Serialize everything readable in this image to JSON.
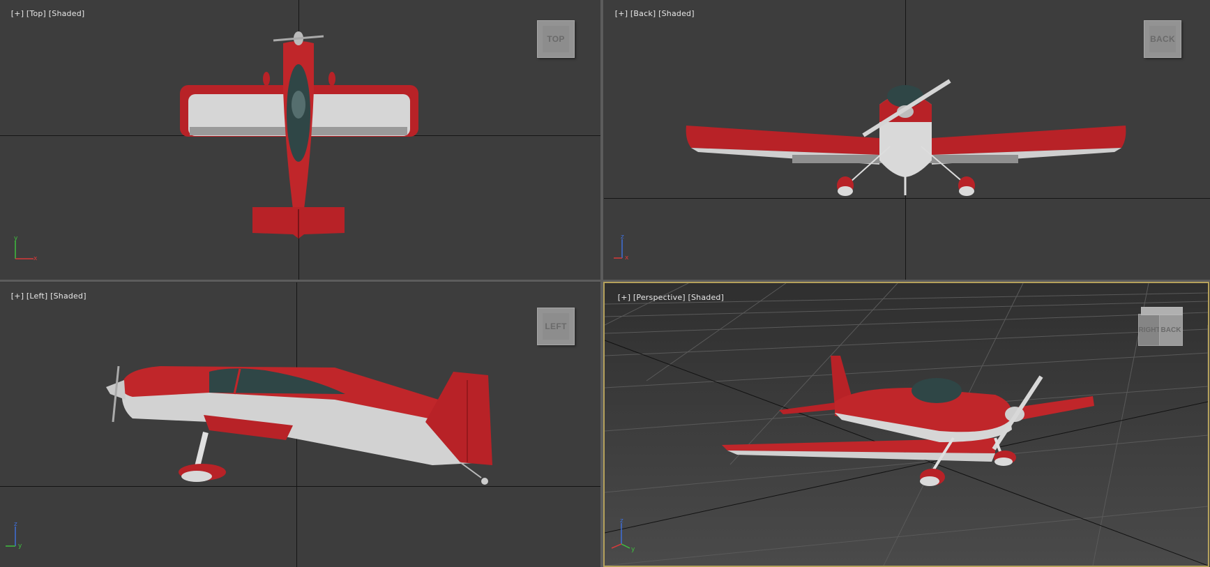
{
  "viewports": {
    "top": {
      "plus": "[+]",
      "view": "[Top]",
      "shading": "[Shaded]",
      "cube": "TOP"
    },
    "back": {
      "plus": "[+]",
      "view": "[Back]",
      "shading": "[Shaded]",
      "cube": "BACK"
    },
    "left": {
      "plus": "[+]",
      "view": "[Left]",
      "shading": "[Shaded]",
      "cube": "LEFT"
    },
    "perspective": {
      "plus": "[+]",
      "view": "[Perspective]",
      "shading": "[Shaded]",
      "cube_face1": "RIGHT",
      "cube_face2": "BACK"
    }
  },
  "axes": {
    "top": {
      "vertical": "y",
      "horizontal": "x"
    },
    "back": {
      "vertical": "z",
      "horizontal": "x"
    },
    "left": {
      "vertical": "z",
      "horizontal": "y"
    },
    "perspective": {
      "vertical": "z",
      "horizontal": "y"
    }
  },
  "colors": {
    "viewport_bg": "#3d3d3d",
    "active_border": "#b5a15b",
    "plane_red": "#c0262a",
    "plane_white": "#d8d8d8",
    "canopy": "#2c4a4a"
  }
}
